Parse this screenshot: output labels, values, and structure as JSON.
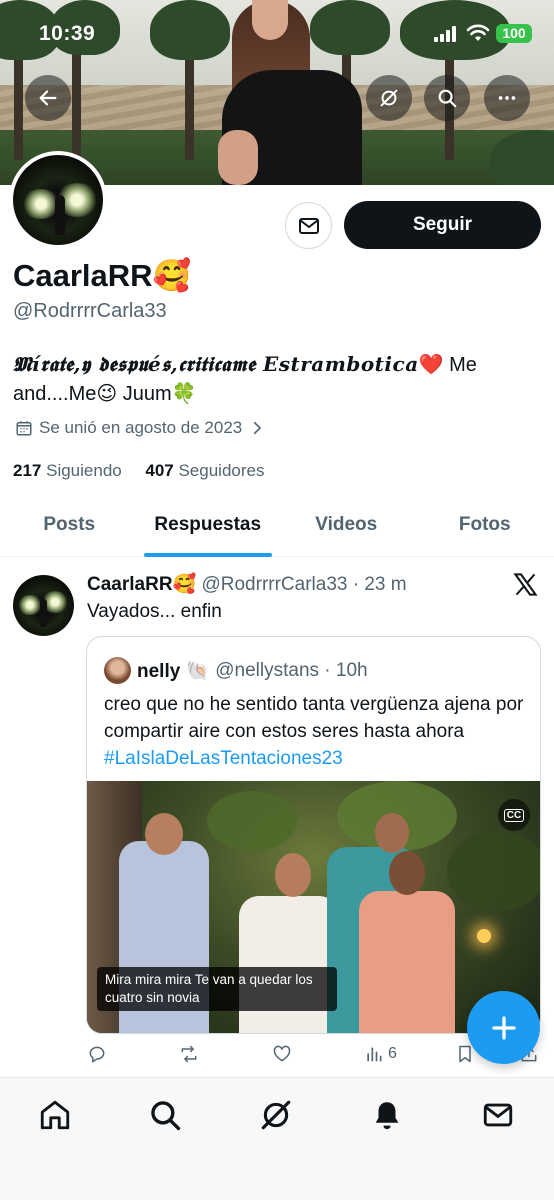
{
  "status_bar": {
    "time": "10:39",
    "battery": "100"
  },
  "profile": {
    "name": "CaarlaRR🥰",
    "handle": "@RodrrrrCarla33",
    "bio_fancy": "𝕸í𝖗𝖆𝖙𝖊,𝖞 𝖉𝖊𝖘𝖕𝖚é𝖘,𝖈𝖗𝖎𝖙𝖎𝖈𝖆𝖒𝖊 𝑬𝒔𝒕𝒓𝒂𝒎𝒃𝒐𝒕𝒊𝒄𝒂",
    "bio_rest": "❤️ Me and....Me😉 Juum🍀",
    "joined": "Se unió en agosto de 2023",
    "following_count": "217",
    "following_label": "Siguiendo",
    "followers_count": "407",
    "followers_label": "Seguidores",
    "follow_button": "Seguir"
  },
  "tabs": [
    {
      "label": "Posts"
    },
    {
      "label": "Respuestas"
    },
    {
      "label": "Videos"
    },
    {
      "label": "Fotos"
    }
  ],
  "active_tab": "Respuestas",
  "tweet": {
    "author": "CaarlaRR🥰",
    "meta": "@RodrrrrCarla33 · 23 m",
    "text": "Vayados... enfin",
    "quote": {
      "author": "nelly 🐚",
      "meta": "@nellystans · 10h",
      "text": "creo que no he sentido tanta vergüenza ajena por compartir aire con estos seres hasta ahora ",
      "hashtag": "#LaIslaDeLasTentaciones23",
      "video_caption": "Mira mira mira Te van a quedar los cuatro sin novia",
      "cc_label": "CC"
    },
    "views": "6"
  },
  "colors": {
    "accent": "#1d9bf0",
    "text": "#0f1419",
    "muted": "#536471",
    "battery": "#37c24b"
  },
  "icons": [
    "back-arrow-icon",
    "grok-icon",
    "search-icon",
    "more-icon",
    "mail-icon",
    "calendar-icon",
    "chevron-right-icon",
    "x-logo-icon",
    "reply-icon",
    "retweet-icon",
    "like-icon",
    "views-icon",
    "bookmark-icon",
    "share-icon",
    "compose-plus-icon",
    "home-icon",
    "notifications-icon"
  ]
}
